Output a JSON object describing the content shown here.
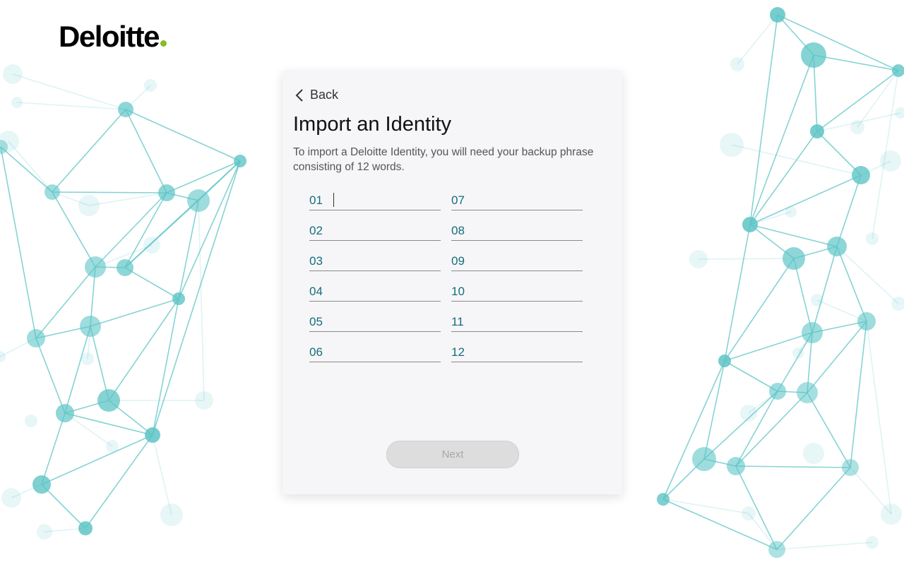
{
  "brand": {
    "logo_text": "Deloitte",
    "dot_color": "#86bc25"
  },
  "nav": {
    "back_label": "Back"
  },
  "page": {
    "title": "Import an Identity",
    "description": "To import a Deloitte Identity, you will need your backup phrase consisting of 12 words."
  },
  "phrase_fields": [
    {
      "number": "01",
      "value": ""
    },
    {
      "number": "02",
      "value": ""
    },
    {
      "number": "03",
      "value": ""
    },
    {
      "number": "04",
      "value": ""
    },
    {
      "number": "05",
      "value": ""
    },
    {
      "number": "06",
      "value": ""
    },
    {
      "number": "07",
      "value": ""
    },
    {
      "number": "08",
      "value": ""
    },
    {
      "number": "09",
      "value": ""
    },
    {
      "number": "10",
      "value": ""
    },
    {
      "number": "11",
      "value": ""
    },
    {
      "number": "12",
      "value": ""
    }
  ],
  "actions": {
    "next_label": "Next",
    "next_enabled": false
  },
  "colors": {
    "accent": "#166d79",
    "network": "#5ec4c6"
  }
}
